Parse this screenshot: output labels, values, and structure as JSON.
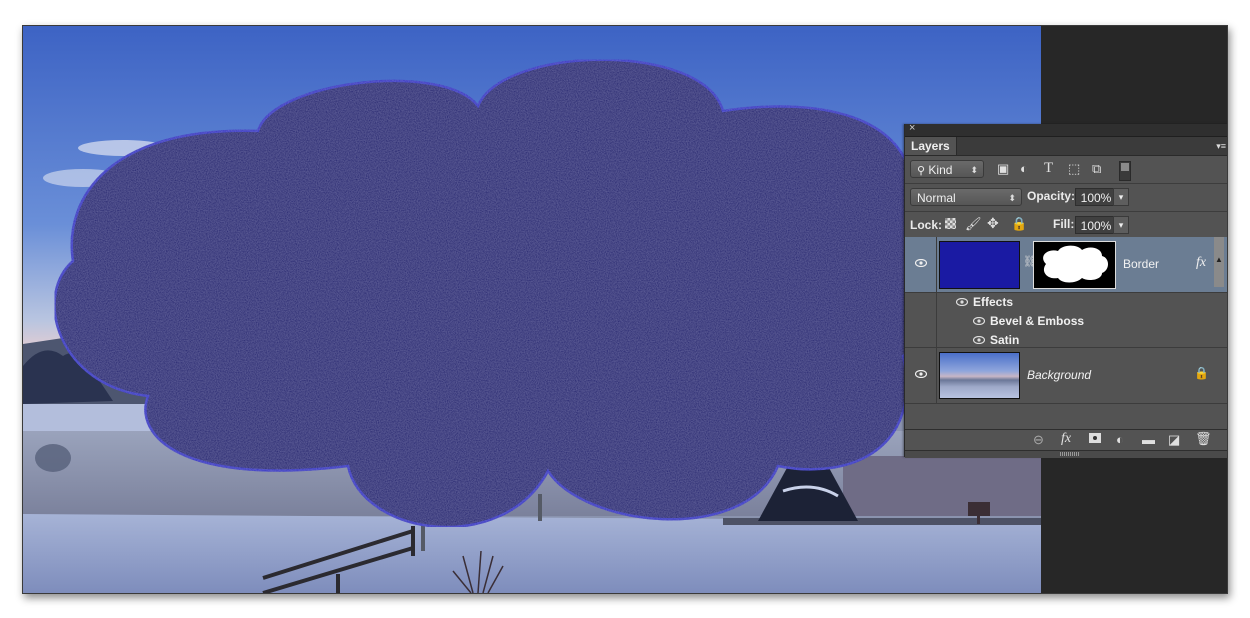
{
  "window": {
    "background": "#272727"
  },
  "canvas": {
    "scene": "snowy-lake-dusk-photo",
    "shape_layer_color": "#16166b",
    "shape": "cloud"
  },
  "layers_panel": {
    "tab_label": "Layers",
    "close_icon": "×",
    "menu_icon": "▾≡",
    "filter": {
      "kind_label": "Kind",
      "filter_icons": [
        "image-filter-icon",
        "adjustment-filter-icon",
        "type-filter-icon",
        "shape-filter-icon",
        "smart-object-filter-icon",
        "filter-toggle-switch"
      ]
    },
    "blend_mode": "Normal",
    "opacity_label": "Opacity:",
    "opacity_value": "100%",
    "lock_label": "Lock:",
    "lock_icons": [
      "lock-transparent-pixels-icon",
      "lock-image-pixels-icon",
      "lock-position-icon",
      "lock-all-icon"
    ],
    "fill_label": "Fill:",
    "fill_value": "100%",
    "layers": [
      {
        "name": "Border",
        "visible": true,
        "selected": true,
        "fill_color": "#1a1aa3",
        "has_mask": true,
        "has_fx": true,
        "fx_label": "fx",
        "effects_label": "Effects",
        "effects": [
          "Bevel & Emboss",
          "Satin"
        ]
      },
      {
        "name": "Background",
        "visible": true,
        "selected": false,
        "locked": true
      }
    ],
    "footer_buttons": [
      "link-layers-button",
      "add-layer-style-button",
      "add-mask-button",
      "new-adjustment-layer-button",
      "new-group-button",
      "new-layer-button",
      "delete-layer-button"
    ],
    "footer_fx_label": "fx"
  }
}
